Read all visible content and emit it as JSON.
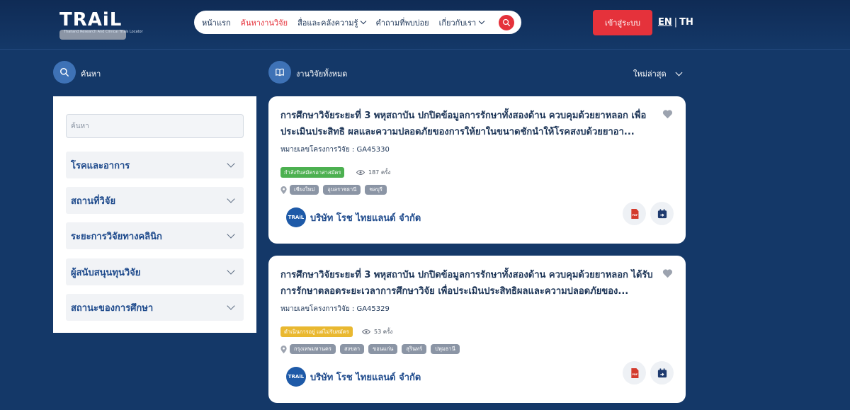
{
  "header": {
    "logo_text": "TRAiL",
    "logo_tagline": "Thailand Research And Clinical Trials Locator",
    "nav": [
      {
        "label": "หน้าแรก",
        "dropdown": false,
        "active": false
      },
      {
        "label": "ค้นหางานวิจัย",
        "dropdown": false,
        "active": true
      },
      {
        "label": "สื่อและคลังความรู้",
        "dropdown": true,
        "active": false
      },
      {
        "label": "คำถามที่พบบ่อย",
        "dropdown": false,
        "active": false
      },
      {
        "label": "เกี่ยวกับเรา",
        "dropdown": true,
        "active": false
      }
    ],
    "login_label": "เข้าสู่ระบบ",
    "lang_en": "EN",
    "lang_sep": "|",
    "lang_th": "TH"
  },
  "sidebar": {
    "heading": "ค้นหา",
    "search_placeholder": "ค้นหา",
    "filters": [
      "โรคและอาการ",
      "สถานที่วิจัย",
      "ระยะการวิจัยทางคลินิก",
      "ผู้สนับสนุนทุนวิจัย",
      "สถานะของการศึกษา"
    ]
  },
  "results": {
    "heading": "งานวิจัยทั้งหมด",
    "sort_label": "ใหม่ล่าสุด",
    "items": [
      {
        "title": "การศึกษาวิจัยระยะที่ 3 พหุสถาบัน ปกปิดข้อมูลการรักษาทั้งสองด้าน ควบคุมด้วยยาหลอก เพื่อประเมินประสิทธิ ผลและความปลอดภัยของการให้ยาในขนาดชักนำให้โรคสงบด้วยยาอา...",
        "project_no": "หมายเลขโครงการวิจัย : GA45330",
        "status": "กำลังรับสมัครอาสาสมัคร",
        "status_color": "#4cb050",
        "views": "187 ครั้ง",
        "locations": [
          "เชียงใหม่",
          "อุบลราชธานี",
          "ชลบุรี"
        ],
        "sponsor": "บริษัท โรช ไทยแลนด์ จำกัด"
      },
      {
        "title": "การศึกษาวิจัยระยะที่ 3 พหุสถาบัน ปกปิดข้อมูลการรักษาทั้งสองด้าน ควบคุมด้วยยาหลอก ได้รับการรักษาตลอดระยะเวลาการศึกษาวิจัย เพื่อประเมินประสิทธิผลและความปลอดภัยของ...",
        "project_no": "หมายเลขโครงการวิจัย : GA45329",
        "status": "ดำเนินการอยู่ แต่ไม่รับสมัคร",
        "status_color": "#e9b830",
        "views": "53 ครั้ง",
        "locations": [
          "กรุงเทพมหานคร",
          "สงขลา",
          "ขอนแก่น",
          "สุรินทร์",
          "ปทุมธานี"
        ],
        "sponsor": "บริษัท โรช ไทยแลนด์ จำกัด"
      }
    ]
  },
  "colors": {
    "brand_red": "#e5323b",
    "navy": "#143868",
    "title_blue": "#1e4a8c"
  }
}
